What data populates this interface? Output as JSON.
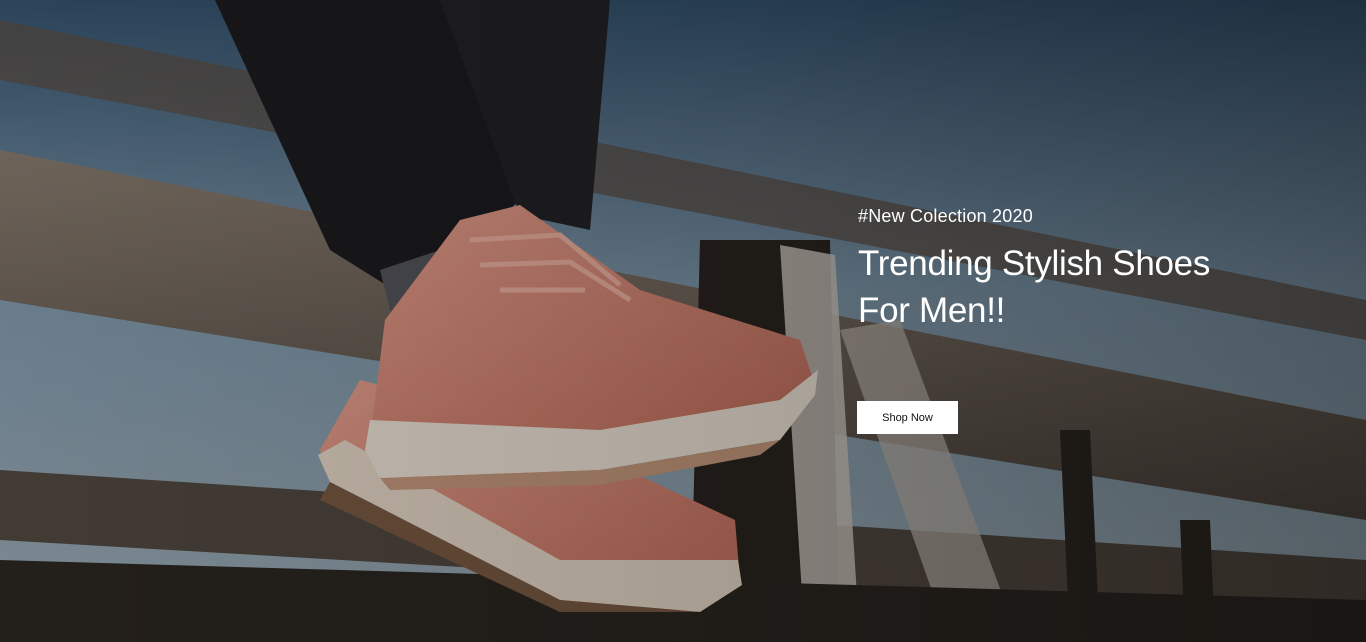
{
  "hero": {
    "eyebrow": "#New Colection 2020",
    "headline_line1": "Trending Stylish Shoes",
    "headline_line2": "For Men!!",
    "cta_label": "Shop Now"
  },
  "colors": {
    "sky": "#6f8aa1",
    "fence_wood": "#6b5a4a",
    "shoe": "#d98a78",
    "sole": "#e9dccb",
    "pants": "#1c1c1f",
    "button_bg": "#ffffff",
    "text": "#ffffff"
  }
}
